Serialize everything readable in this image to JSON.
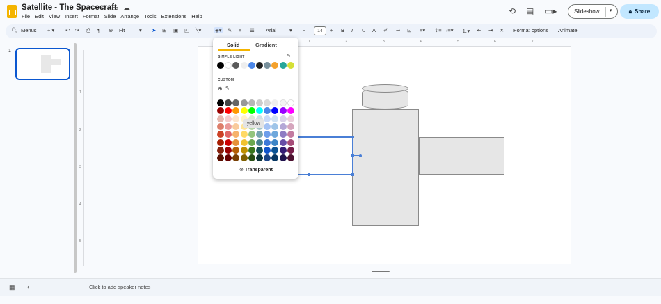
{
  "app": {
    "doc_title": "Satellite - The Spacecraft",
    "menus": [
      "File",
      "Edit",
      "View",
      "Insert",
      "Format",
      "Slide",
      "Arrange",
      "Tools",
      "Extensions",
      "Help"
    ],
    "slideshow_label": "Slideshow",
    "share_label": "Share"
  },
  "toolbar": {
    "menus_label": "Menus",
    "zoom_label": "Fit",
    "font_name": "Arial",
    "font_size": "14",
    "format_options_label": "Format options",
    "animate_label": "Animate"
  },
  "filmstrip": {
    "slide_number": "1"
  },
  "ruler": {
    "top_ticks": [
      "1",
      "2",
      "3",
      "4",
      "5",
      "6",
      "7"
    ],
    "left_ticks": [
      "1",
      "2",
      "3",
      "4",
      "5"
    ]
  },
  "color_picker": {
    "tab_solid": "Solid",
    "tab_gradient": "Gradient",
    "section_theme": "SIMPLE LIGHT",
    "section_custom": "CUSTOM",
    "tooltip": "yellow",
    "transparent_label": "Transparent",
    "theme_colors": [
      "#000000",
      "#ffffff",
      "#595959",
      "#eeeeee",
      "#4a86e8",
      "#212121",
      "#78909c",
      "#f4a12c",
      "#26a69a",
      "#d5e037"
    ],
    "palette": [
      [
        "#000000",
        "#434343",
        "#666666",
        "#999999",
        "#b7b7b7",
        "#cccccc",
        "#d9d9d9",
        "#efefef",
        "#f3f3f3",
        "#ffffff"
      ],
      [
        "#980000",
        "#ff0000",
        "#ff9900",
        "#ffff00",
        "#00ff00",
        "#00ffff",
        "#4a86e8",
        "#0000ff",
        "#9900ff",
        "#ff00ff"
      ],
      [
        "#e6b8af",
        "#f4cccc",
        "#fce5cd",
        "#fff2cc",
        "#d9ead3",
        "#d0e0e3",
        "#c9daf8",
        "#cfe2f3",
        "#d9d2e9",
        "#ead1dc"
      ],
      [
        "#dd7e6b",
        "#ea9999",
        "#f9cb9c",
        "#ffe599",
        "#b6d7a8",
        "#a2c4c9",
        "#a4c2f4",
        "#9fc5e8",
        "#b4a7d6",
        "#d5a6bd"
      ],
      [
        "#cc4125",
        "#e06666",
        "#f6b26b",
        "#ffd966",
        "#93c47d",
        "#76a5af",
        "#6d9eeb",
        "#6fa8dc",
        "#8e7cc3",
        "#c27ba0"
      ],
      [
        "#a61c00",
        "#cc0000",
        "#e69138",
        "#f1c232",
        "#6aa84f",
        "#45818e",
        "#3c78d8",
        "#3d85c6",
        "#674ea7",
        "#a64d79"
      ],
      [
        "#85200c",
        "#990000",
        "#b45f06",
        "#bf9000",
        "#38761d",
        "#134f5c",
        "#1155cc",
        "#0b5394",
        "#351c75",
        "#741b47"
      ],
      [
        "#5b0f00",
        "#660000",
        "#783f04",
        "#7f6000",
        "#274e13",
        "#0c343d",
        "#1c4587",
        "#073763",
        "#20124d",
        "#4c1130"
      ]
    ]
  },
  "notes": {
    "placeholder": "Click to add speaker notes"
  }
}
